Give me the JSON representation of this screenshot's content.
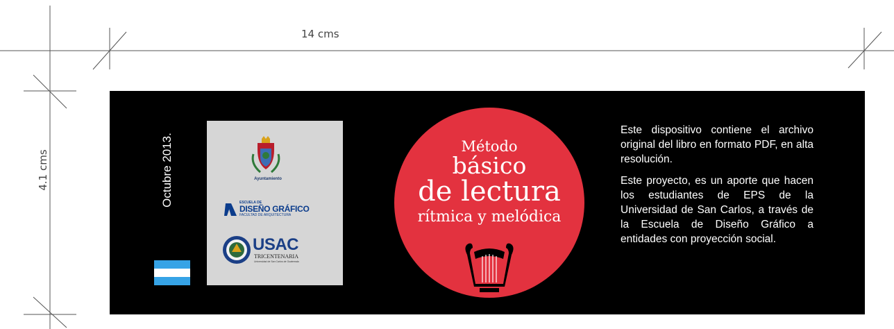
{
  "dimensions": {
    "width_label": "14 cms",
    "height_label": "4.1 cms"
  },
  "label": {
    "date": "Octubre 2013.",
    "flag_colors": [
      "#36a3e6",
      "#ffffff",
      "#36a3e6"
    ],
    "logos": {
      "municipality_title": "Ayuntamiento",
      "design_school_top": "ESCUELA DE",
      "design_school_name": "DISEÑO GRÁFICO",
      "design_school_sub": "FACULTAD DE ARQUITECTURA",
      "usac_name": "USAC",
      "usac_sub": "TRICENTENARIA",
      "usac_sub2": "Universidad de San Carlos de Guatemala"
    },
    "title": {
      "line1": "Método",
      "line2": "básico",
      "line3": "de lectura",
      "line4": "rítmica y melódica",
      "circle_color": "#e3323f"
    },
    "info": {
      "paragraph1": "Este dispositivo contiene el archivo original del libro en formato PDF, en alta resolución.",
      "paragraph2": "Este proyecto, es un aporte que hacen los estudiantes de EPS de la Universidad de San Carlos, a través de la Escuela de Diseño Gráfico a entidades con proyección social."
    }
  }
}
